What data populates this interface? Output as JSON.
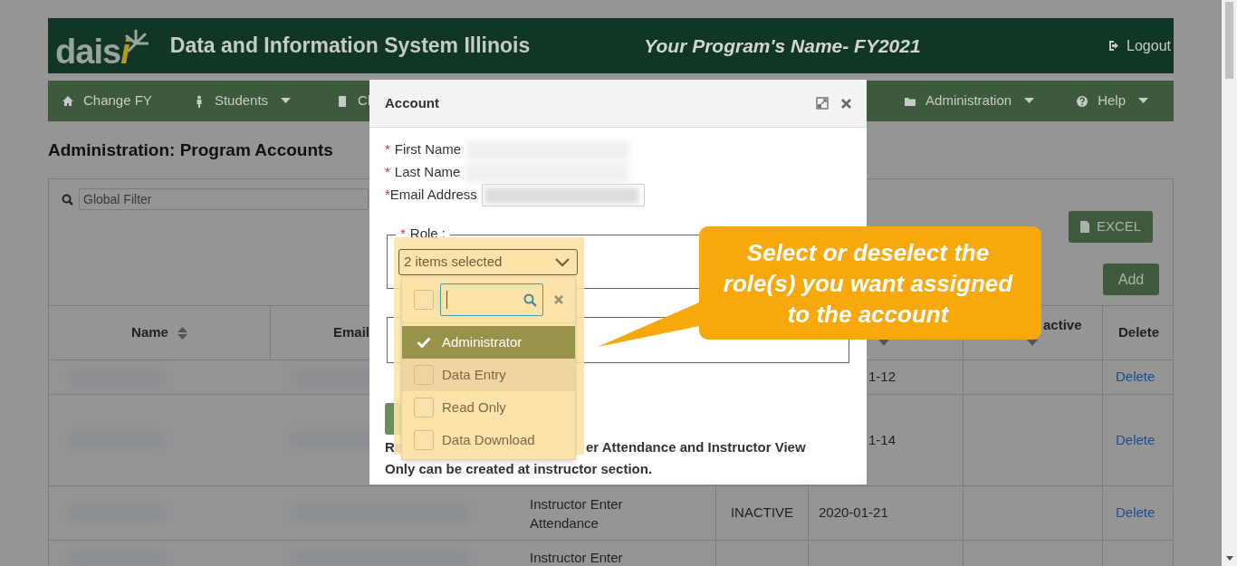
{
  "header": {
    "logo_main": "dais",
    "logo_accent": "i",
    "title": "Data and Information System Illinois",
    "program": "Your Program's Name- FY2021",
    "logout": "Logout"
  },
  "nav": [
    {
      "label": "Change FY",
      "caret": false
    },
    {
      "label": "Students",
      "caret": true
    },
    {
      "label": "Cl",
      "caret": false
    },
    {
      "label": "Administration",
      "caret": true
    },
    {
      "label": "Help",
      "caret": true
    }
  ],
  "page_title": "Administration: Program Accounts",
  "filter": {
    "placeholder": "Global Filter"
  },
  "buttons": {
    "excel": "EXCEL",
    "add": "Add"
  },
  "table": {
    "columns": [
      {
        "label": "Name",
        "sortable": true
      },
      {
        "label": "Email",
        "sortable": false
      },
      {
        "sortable": true
      },
      {
        "label": "active",
        "sortable": true
      },
      {
        "label": "Delete",
        "sortable": false
      }
    ],
    "rows": [
      {
        "date": "1-12",
        "delete": "Delete",
        "redacted": true
      },
      {
        "date": "1-14",
        "delete": "Delete",
        "redacted": true
      },
      {
        "role": "Instructor Enter Attendance",
        "status": "INACTIVE",
        "date": "2020-01-21",
        "delete": "Delete",
        "redacted": true
      },
      {
        "role": "Instructor Enter",
        "redacted": true
      }
    ]
  },
  "modal": {
    "title": "Account",
    "fields": [
      {
        "required_mark": "*",
        "label": "First Name",
        "kind": "blurred"
      },
      {
        "required_mark": "*",
        "label": "Last Name",
        "kind": "blurred"
      },
      {
        "required_mark": "*",
        "label": "Email Address",
        "kind": "input"
      }
    ],
    "role_required_mark": "*",
    "role_legend": "Role :",
    "dropdown": {
      "value": "2 items selected",
      "expanded": true
    },
    "select_all_checked": false,
    "options": [
      {
        "label": "Administrator",
        "checked": true,
        "selected": true,
        "hovered": false
      },
      {
        "label": "Data Entry",
        "checked": false,
        "selected": false,
        "hovered": true
      },
      {
        "label": "Read Only",
        "checked": false,
        "selected": false,
        "hovered": false
      },
      {
        "label": "Data Download",
        "checked": false,
        "selected": false,
        "hovered": false
      }
    ],
    "note_start": "Re",
    "note_rest": "er Attendance and Instructor View",
    "note_line2": "Only can be created at instructor section."
  },
  "callout": {
    "text": "Select or deselect the role(s) you want assigned to the account"
  }
}
